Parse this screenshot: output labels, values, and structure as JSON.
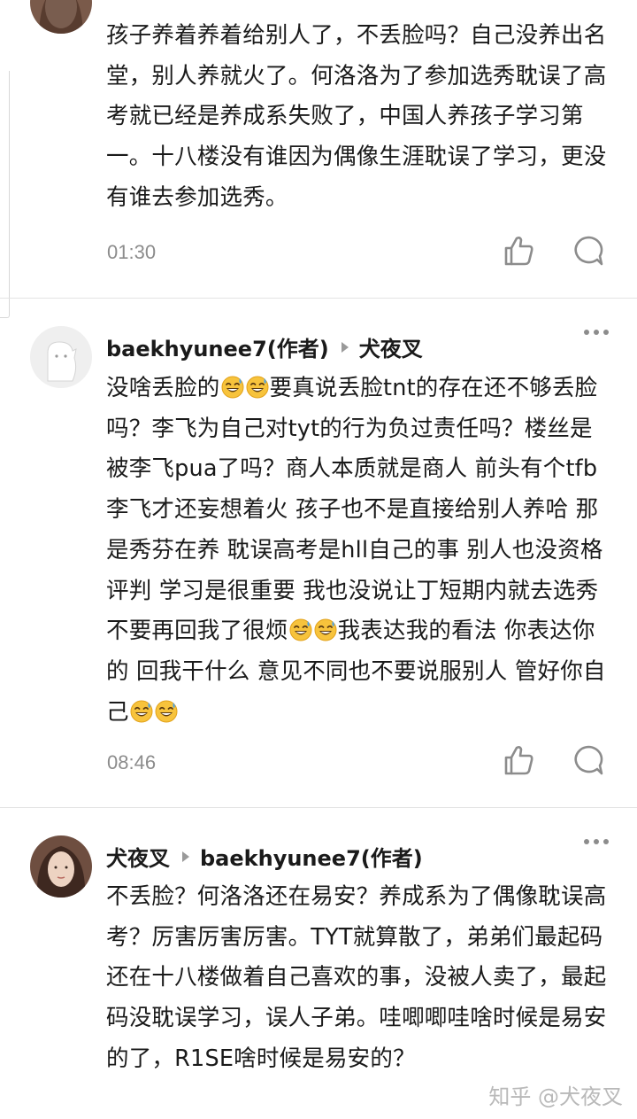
{
  "comments": [
    {
      "text": "孩子养着养着给别人了，不丢脸吗？自己没养出名堂，别人养就火了。何洛洛为了参加选秀耽误了高考就已经是养成系失败了，中国人养孩子学习第一。十八楼没有谁因为偶像生涯耽误了学习，更没有谁去参加选秀。",
      "time": "01:30"
    },
    {
      "author": "baekhyunee7(作者)",
      "reply_to": "犬夜叉",
      "text_parts": [
        "没啥丢脸的",
        "要真说丢脸tnt的存在还不够丢脸吗？李飞为自己对tyt的行为负过责任吗？楼丝是被李飞pua了吗？商人本质就是商人 前头有个tfb 李飞才还妄想着火 孩子也不是直接给别人养哈 那是秀芬在养 耽误高考是hll自己的事 别人也没资格评判 学习是很重要 我也没说让丁短期内就去选秀 不要再回我了很烦",
        "我表达我的看法 你表达你的 回我干什么 意见不同也不要说服别人 管好你自己"
      ],
      "time": "08:46"
    },
    {
      "author": "犬夜叉",
      "reply_to": "baekhyunee7(作者)",
      "text": "不丢脸？何洛洛还在易安？养成系为了偶像耽误高考？厉害厉害厉害。TYT就算散了，弟弟们最起码还在十八楼做着自己喜欢的事，没被人卖了，最起码没耽误学习，误人子弟。哇唧唧哇啥时候是易安的了，R1SE啥时候是易安的？"
    }
  ],
  "watermark": "知乎 @犬夜叉",
  "icons": {
    "emoji": "grinning-sweat-emoji",
    "like": "thumbs-up-icon",
    "reply": "comment-bubble-icon",
    "more": "more-dots-icon"
  },
  "colors": {
    "text": "#1a1a1a",
    "muted": "#8c8c8c",
    "divider": "#e3e3e3",
    "watermark": "#b9b9b9",
    "emoji": "#f7c33c"
  }
}
